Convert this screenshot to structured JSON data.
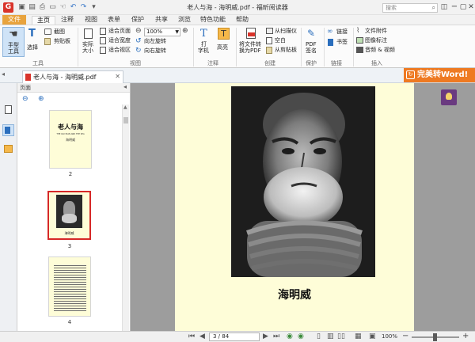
{
  "titlebar": {
    "file_label": "文件",
    "title": "老人与海 - 海明威.pdf - 福昕阅读器",
    "search_placeholder": "搜索",
    "min": "−",
    "restore": "▢",
    "close": "✕",
    "options": "◫"
  },
  "menu": [
    "主页",
    "注释",
    "视图",
    "表单",
    "保护",
    "共享",
    "浏览",
    "特色功能",
    "帮助"
  ],
  "ribbon": {
    "hand_tool_1": "手型",
    "hand_tool_2": "工具",
    "select": "选择",
    "screenshot": "截图",
    "clipboard": "剪贴板",
    "group_tools": "工具",
    "actual_size_1": "实际",
    "actual_size_2": "大小",
    "fit_page": "适合页面",
    "fit_width": "适合宽度",
    "fit_visible": "适合视区",
    "zoom_value": "100%",
    "rotate_left": "向左旋转",
    "rotate_right": "向右旋转",
    "group_view": "视图",
    "typewriter_1": "打",
    "typewriter_2": "字机",
    "highlight": "高亮",
    "group_comment": "注释",
    "convert_1": "将文件转",
    "convert_2": "换为PDF",
    "from_scanner": "从扫描仪",
    "blank": "空白",
    "from_clipboard": "从剪贴板",
    "group_create": "创建",
    "pdf_sign_1": "PDF",
    "pdf_sign_2": "签名",
    "group_protect": "保护",
    "link": "链接",
    "bookmark": "书签",
    "group_links": "链接",
    "file_attach": "文件附件",
    "image_annot": "图像标注",
    "audio_video": "音频 & 视频",
    "group_insert": "插入"
  },
  "doc_tab": {
    "label": "老人与海 - 海明威.pdf",
    "close": "✕"
  },
  "promo": "完美转Word!",
  "thumbnails": {
    "header": "页面",
    "pages": [
      {
        "num": "2",
        "title": "老人与海",
        "line": "THE OLD MAN AND THE SEA",
        "author": "海明威"
      },
      {
        "num": "3",
        "caption": "海明威"
      },
      {
        "num": "4"
      }
    ]
  },
  "page": {
    "caption": "海明威"
  },
  "status": {
    "page_indicator": "3 / 84",
    "zoom": "100%",
    "zoom_minus": "−",
    "zoom_plus": "+"
  },
  "colors": {
    "accent": "#2a6ebd",
    "file_button": "#e8a33d",
    "promo": "#ee7a22",
    "page_bg": "#fefdd8",
    "selection": "#d62828"
  }
}
